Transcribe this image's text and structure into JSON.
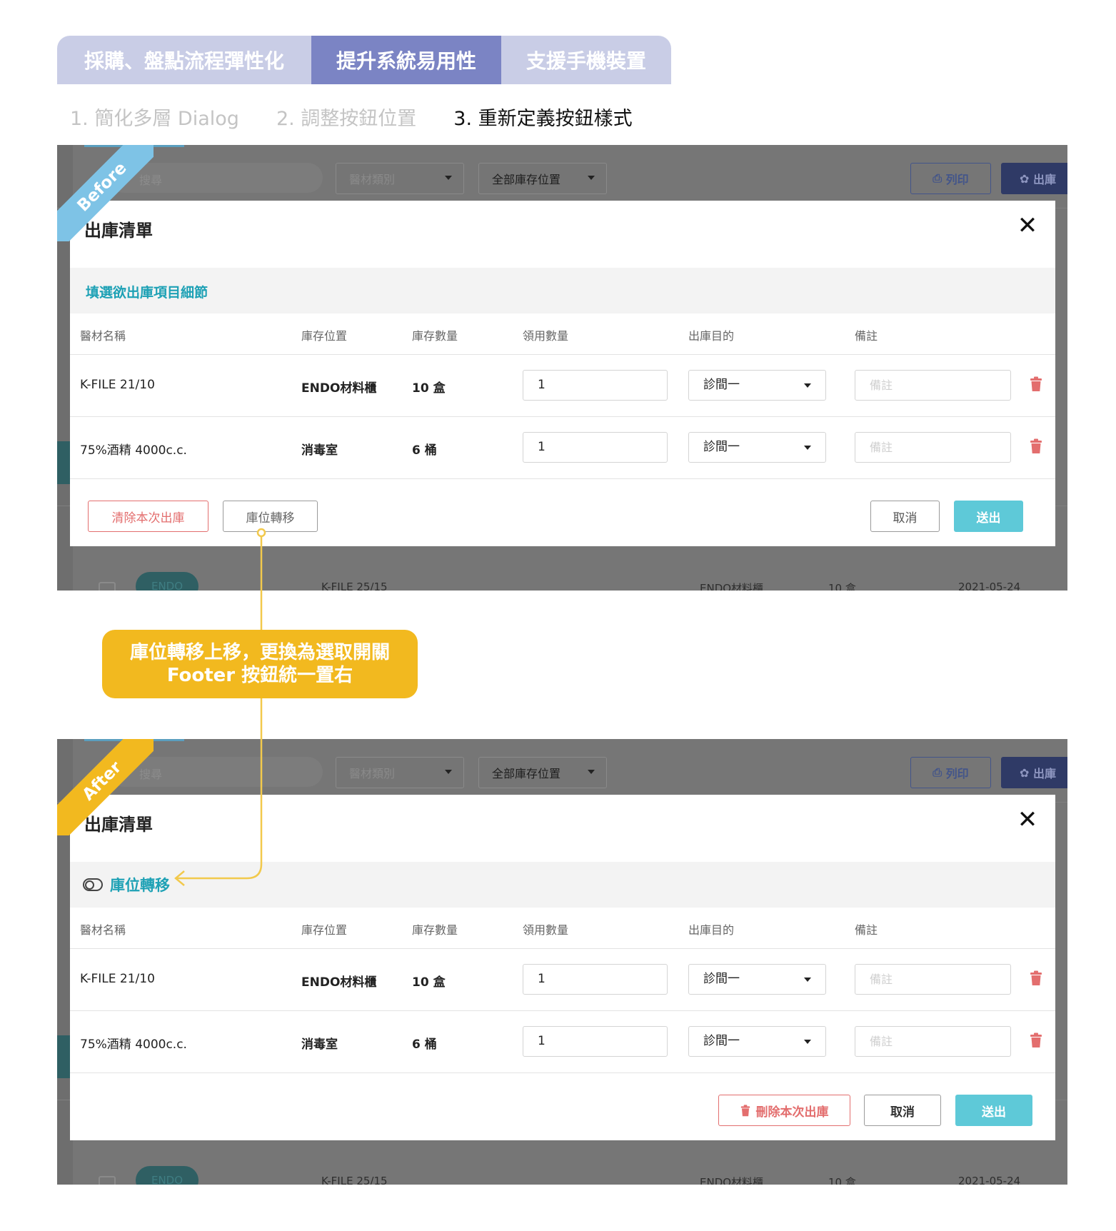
{
  "top_tabs": [
    {
      "label": "採購、盤點流程彈性化",
      "active": false
    },
    {
      "label": "提升系統易用性",
      "active": true
    },
    {
      "label": "支援手機裝置",
      "active": false
    }
  ],
  "sub_steps": [
    {
      "label": "1. 簡化多層 Dialog",
      "active": false
    },
    {
      "label": "2. 調整按鈕位置",
      "active": false
    },
    {
      "label": "3. 重新定義按鈕樣式",
      "active": true
    }
  ],
  "colors": {
    "tab_active": "#7b84c4",
    "tab_inactive": "#c9cde6",
    "accent_teal": "#1ea1b5",
    "submit": "#5ec9d8",
    "danger": "#e36e6e",
    "ribbon_before": "#7ec3e6",
    "ribbon_after": "#f2b91f"
  },
  "background_page": {
    "search_placeholder": "搜尋",
    "category_select": "醫材類別",
    "location_select": "全部庫存位置",
    "print_button": "列印",
    "outbound_button": "出庫",
    "row_tag": "ENDO",
    "row_name": "K-FILE 25/15",
    "row_location": "ENDO材料櫃",
    "row_stock": "10 盒",
    "row_date": "2021-05-24"
  },
  "before": {
    "ribbon": "Before",
    "modal_title": "出庫清單",
    "band_title": "填選欲出庫項目細節",
    "columns": [
      "醫材名稱",
      "庫存位置",
      "庫存數量",
      "領用數量",
      "出庫目的",
      "備註"
    ],
    "rows": [
      {
        "name": "K-FILE 21/10",
        "location": "ENDO材料櫃",
        "stock": "10 盒",
        "qty": "1",
        "purpose": "診間一",
        "note_placeholder": "備註"
      },
      {
        "name": "75%酒精 4000c.c.",
        "location": "消毒室",
        "stock": "6 桶",
        "qty": "1",
        "purpose": "診間一",
        "note_placeholder": "備註"
      }
    ],
    "buttons": {
      "clear": "清除本次出庫",
      "move": "庫位轉移",
      "cancel": "取消",
      "submit": "送出"
    }
  },
  "after": {
    "ribbon": "After",
    "modal_title": "出庫清單",
    "toggle_label": "庫位轉移",
    "columns": [
      "醫材名稱",
      "庫存位置",
      "庫存數量",
      "領用數量",
      "出庫目的",
      "備註"
    ],
    "rows": [
      {
        "name": "K-FILE 21/10",
        "location": "ENDO材料櫃",
        "stock": "10 盒",
        "qty": "1",
        "purpose": "診間一",
        "note_placeholder": "備註"
      },
      {
        "name": "75%酒精 4000c.c.",
        "location": "消毒室",
        "stock": "6 桶",
        "qty": "1",
        "purpose": "診間一",
        "note_placeholder": "備註"
      }
    ],
    "buttons": {
      "delete": "刪除本次出庫",
      "cancel": "取消",
      "submit": "送出"
    }
  },
  "callout": {
    "line1": "庫位轉移上移，更換為選取開關",
    "line2": "Footer 按鈕統一置右"
  }
}
